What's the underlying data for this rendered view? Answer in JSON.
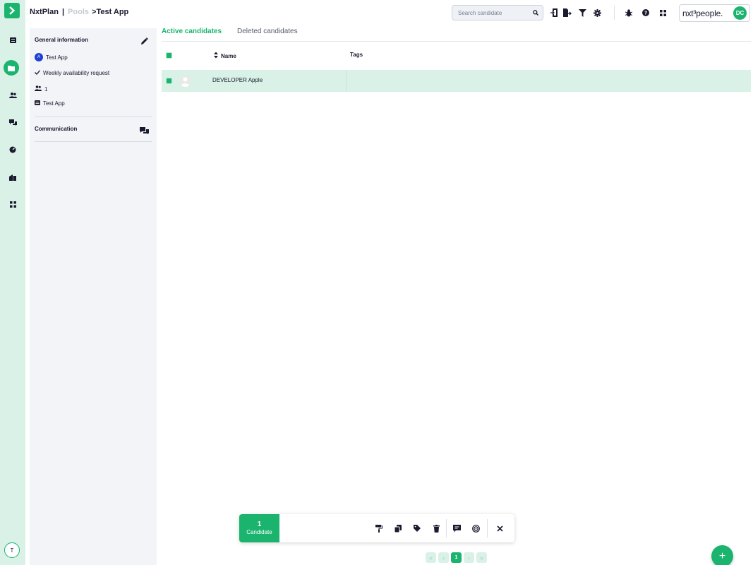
{
  "colors": {
    "accent": "#1ab46e",
    "accent_light": "#d9f1e7",
    "panel_bg": "#f2f4f8",
    "pool_avatar": "#1e3fd1"
  },
  "breadcrumb": {
    "app": "NxtPlan",
    "separator": "|",
    "pools": "Pools",
    "current_prefix": ">",
    "current": "Test App"
  },
  "search": {
    "placeholder": "Search candidate",
    "value": ""
  },
  "brand": {
    "logo_text": "nxt³people.",
    "user_initials": "DC"
  },
  "rail": {
    "icons": [
      "chevron-right-icon",
      "list-icon",
      "folder-icon",
      "users-icon",
      "chat-icon",
      "speedometer-icon",
      "building-icon",
      "grid-icon"
    ],
    "user_initial": "T"
  },
  "side_panel": {
    "general_title": "General information",
    "pool_avatar_letter": "A",
    "pool_name": "Test App",
    "availability": "Weekly availability request",
    "member_count": "1",
    "client": "Test App",
    "communication_title": "Communication"
  },
  "tabs": [
    {
      "label": "Active candidates",
      "active": true
    },
    {
      "label": "Deleted candidates",
      "active": false
    }
  ],
  "table": {
    "headers": {
      "name": "Name",
      "tags": "Tags"
    },
    "rows": [
      {
        "name": "DEVELOPER Apple",
        "tags": "",
        "selected": true
      }
    ]
  },
  "action_bar": {
    "count": "1",
    "count_label": "Candidate",
    "icons": [
      "paint-roller-icon",
      "copy-icon",
      "tag-icon",
      "trash-icon",
      "message-icon",
      "target-icon",
      "close-icon"
    ]
  },
  "pagination": {
    "current_page": "1",
    "first": "«",
    "prev": "‹",
    "next": "›",
    "last": "»"
  },
  "fab": {
    "label": "+"
  }
}
